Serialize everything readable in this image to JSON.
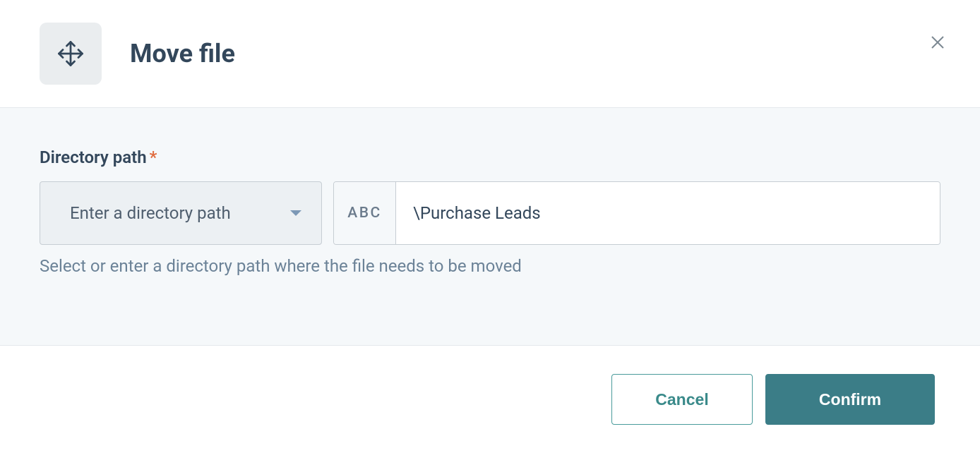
{
  "dialog": {
    "title": "Move file",
    "close_label": "Close"
  },
  "form": {
    "directory_path_label": "Directory path",
    "required_mark": "*",
    "select_placeholder": "Enter a directory path",
    "abc_prefix": "ABC",
    "path_value": "\\Purchase Leads",
    "help_text": "Select or enter a directory path where the file needs to be moved"
  },
  "footer": {
    "cancel_label": "Cancel",
    "confirm_label": "Confirm"
  }
}
